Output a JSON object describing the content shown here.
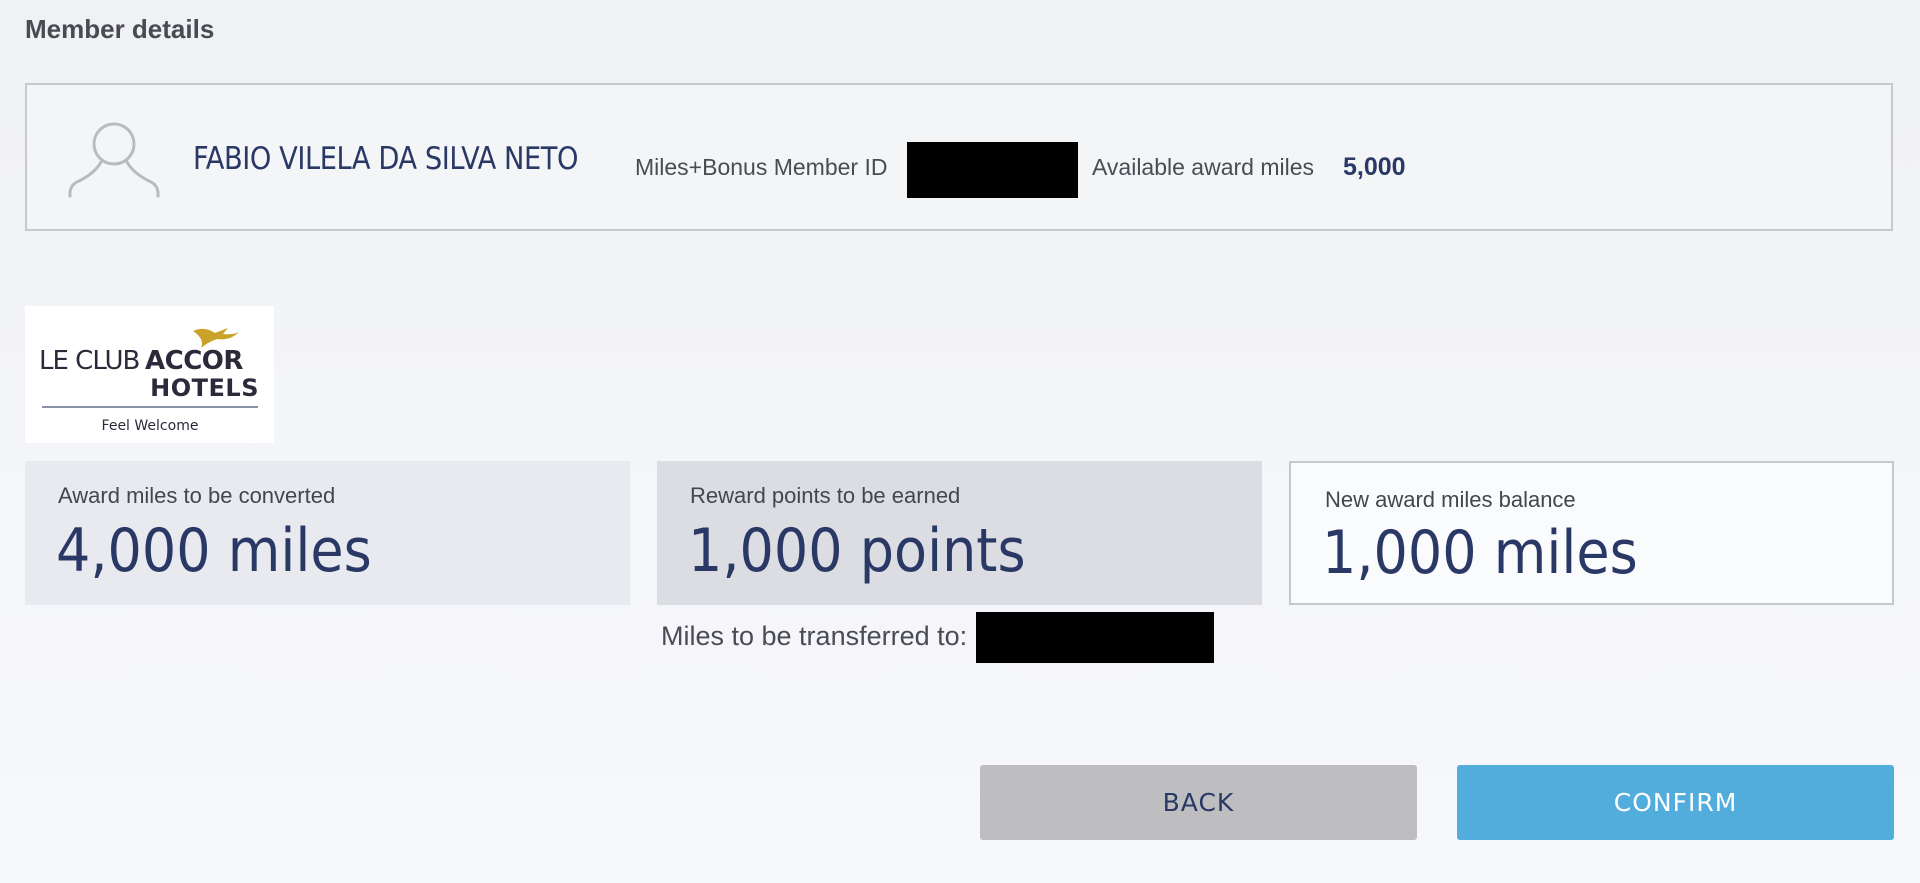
{
  "page": {
    "section_title": "Member details"
  },
  "member": {
    "name": "FABIO VILELA DA SILVA NETO",
    "id_label": "Miles+Bonus Member ID",
    "available_label": "Available award miles",
    "available_value": "5,000"
  },
  "partner": {
    "logo_line1_light": "LE CLUB",
    "logo_line1_bold": "ACCOR",
    "logo_line2": "HOTELS",
    "logo_tagline": "Feel Welcome"
  },
  "conversion": {
    "miles_label": "Award miles to be converted",
    "miles_value": "4,000 miles",
    "points_label": "Reward points to be earned",
    "points_value": "1,000 points",
    "balance_label": "New award miles balance",
    "balance_value": "1,000 miles",
    "transfer_label": "Miles to be transferred to:"
  },
  "actions": {
    "back_label": "BACK",
    "confirm_label": "CONFIRM"
  },
  "colors": {
    "brand_navy": "#2a3866",
    "confirm_blue": "#52acdc",
    "back_gray": "#bebec0",
    "logo_gold": "#c9a227"
  },
  "icons": {
    "avatar": "user-silhouette-icon",
    "logo_bird": "bird-icon"
  }
}
